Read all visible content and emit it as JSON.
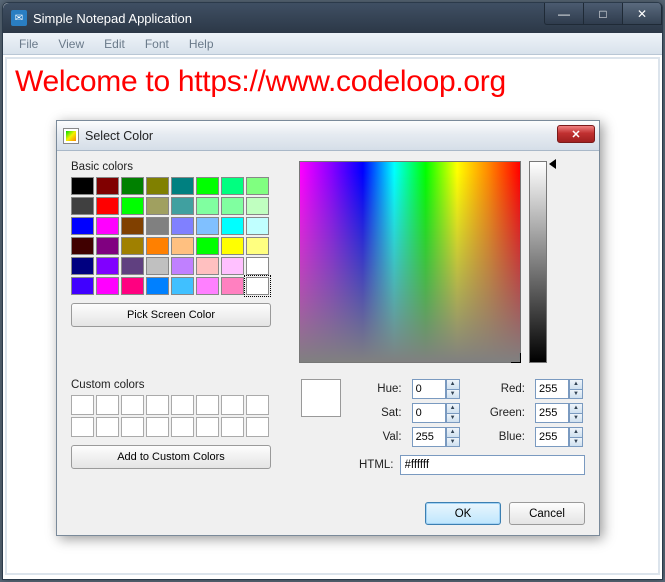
{
  "window": {
    "title": "Simple Notepad Application",
    "icon_name": "app-icon"
  },
  "menubar": [
    "File",
    "View",
    "Edit",
    "Font",
    "Help"
  ],
  "editor": {
    "content": "Welcome to https://www.codeloop.org",
    "text_color": "#ff0000"
  },
  "dialog": {
    "title": "Select Color",
    "basic_label": "Basic colors",
    "pick_screen": "Pick Screen Color",
    "custom_label": "Custom colors",
    "add_custom": "Add to Custom Colors",
    "ok": "OK",
    "cancel": "Cancel",
    "html_label": "HTML:",
    "html_value": "#ffffff",
    "fields": {
      "hue_label": "Hue:",
      "hue": "0",
      "sat_label": "Sat:",
      "sat": "0",
      "val_label": "Val:",
      "val": "255",
      "red_label": "Red:",
      "red": "255",
      "green_label": "Green:",
      "green": "255",
      "blue_label": "Blue:",
      "blue": "255"
    },
    "basic_colors": [
      "#000000",
      "#800000",
      "#008000",
      "#808000",
      "#008080",
      "#00ff00",
      "#00ff80",
      "#80ff80",
      "#404040",
      "#ff0000",
      "#00ff00",
      "#a0a060",
      "#40a0a0",
      "#80ffa0",
      "#80ffa0",
      "#c0ffc0",
      "#0000ff",
      "#ff00ff",
      "#804000",
      "#808080",
      "#8080ff",
      "#80c0ff",
      "#00ffff",
      "#c0ffff",
      "#400000",
      "#800080",
      "#a08000",
      "#ff8000",
      "#ffc080",
      "#00ff00",
      "#ffff00",
      "#ffff80",
      "#000080",
      "#8000ff",
      "#604080",
      "#c0c0c0",
      "#c080ff",
      "#ffc0c0",
      "#ffc0ff",
      "#ffffff",
      "#4000ff",
      "#ff00ff",
      "#ff0080",
      "#0080ff",
      "#40c0ff",
      "#ff80ff",
      "#ff80c0",
      "#ffffff"
    ],
    "selected_index": 47,
    "custom_colors_count": 16,
    "preview_color": "#ffffff"
  },
  "icons": {
    "minimize": "—",
    "maximize": "□",
    "close": "✕",
    "up": "▲",
    "down": "▼"
  }
}
